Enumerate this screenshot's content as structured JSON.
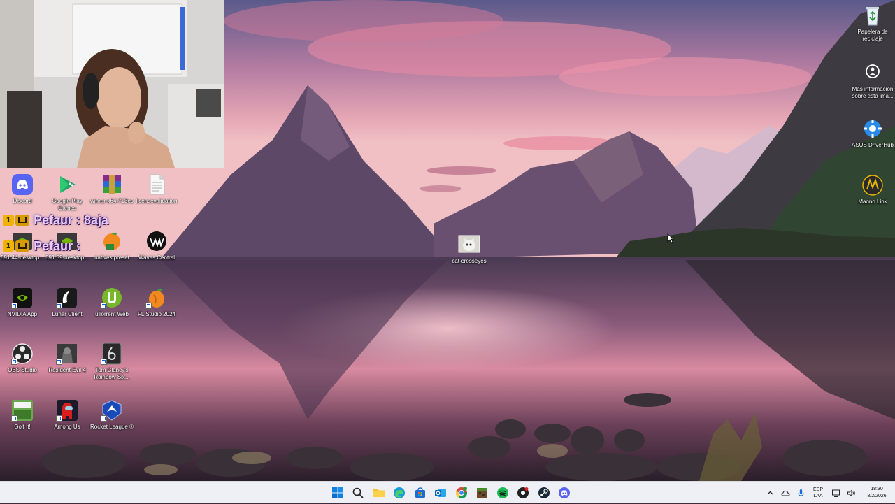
{
  "desktop": {
    "left_icons": [
      {
        "name": "discord-icon",
        "label": "Discord",
        "shortcut": false
      },
      {
        "name": "google-play-games-icon",
        "label": "Google Play Games",
        "shortcut": false
      },
      {
        "name": "winrar-icon",
        "label": "winrar-x64-713es",
        "shortcut": false
      },
      {
        "name": "document-icon",
        "label": "licensevalidation",
        "shortcut": false
      },
      {
        "name": "nvidia-driver-icon",
        "label": "591.44-desktop...",
        "shortcut": false
      },
      {
        "name": "nvidia-driver-icon",
        "label": "591.59-desktop...",
        "shortcut": false
      },
      {
        "name": "fl-preset-icon",
        "label": "natives preset",
        "shortcut": false
      },
      {
        "name": "waves-central-icon",
        "label": "Waves Central",
        "shortcut": false
      },
      {
        "name": "nvidia-app-icon",
        "label": "NVIDIA App",
        "shortcut": true
      },
      {
        "name": "lunar-client-icon",
        "label": "Lunar Client",
        "shortcut": true
      },
      {
        "name": "utorrent-icon",
        "label": "uTorrent Web",
        "shortcut": true
      },
      {
        "name": "fl-studio-icon",
        "label": "FL Studio 2024",
        "shortcut": true
      },
      {
        "name": "obs-studio-icon",
        "label": "OBS Studio",
        "shortcut": true
      },
      {
        "name": "resident-evil-icon",
        "label": "Resident Evil 4",
        "shortcut": true
      },
      {
        "name": "rainbow-six-icon",
        "label": "Tom Clancy's Rainbow Six...",
        "shortcut": true
      },
      {
        "name": "golf-it-icon",
        "label": "Golf It!",
        "shortcut": true
      },
      {
        "name": "among-us-icon",
        "label": "Among Us",
        "shortcut": true
      },
      {
        "name": "rocket-league-icon",
        "label": "Rocket League ®",
        "shortcut": true
      }
    ],
    "center_icon": {
      "name": "cat-image-icon",
      "label": "cat-crosseyes"
    },
    "right_icons": [
      {
        "name": "recycle-bin-icon",
        "label": "Papelera de reciclaje"
      },
      {
        "name": "info-icon",
        "label": "Más información sobre esta ima..."
      },
      {
        "name": "asus-driverhub-icon",
        "label": "ASUS DriverHub"
      },
      {
        "name": "maono-link-icon",
        "label": "Maono Link"
      }
    ]
  },
  "chat": [
    {
      "badge": "1",
      "text": "Pefaur : 8aja"
    },
    {
      "badge": "1",
      "text": "Pefaur :"
    }
  ],
  "taskbar": {
    "apps": [
      "start",
      "search",
      "file-explorer",
      "edge",
      "store",
      "outlook",
      "chrome",
      "minecraft",
      "spotify",
      "music-app",
      "steam",
      "discord"
    ],
    "tray": {
      "lang_top": "ESP",
      "lang_bottom": "LAA",
      "time": "18:30",
      "date": "8/2/2026"
    }
  },
  "colors": {
    "taskbar_bg": "#eef0f5",
    "accent": "#0067c0"
  }
}
